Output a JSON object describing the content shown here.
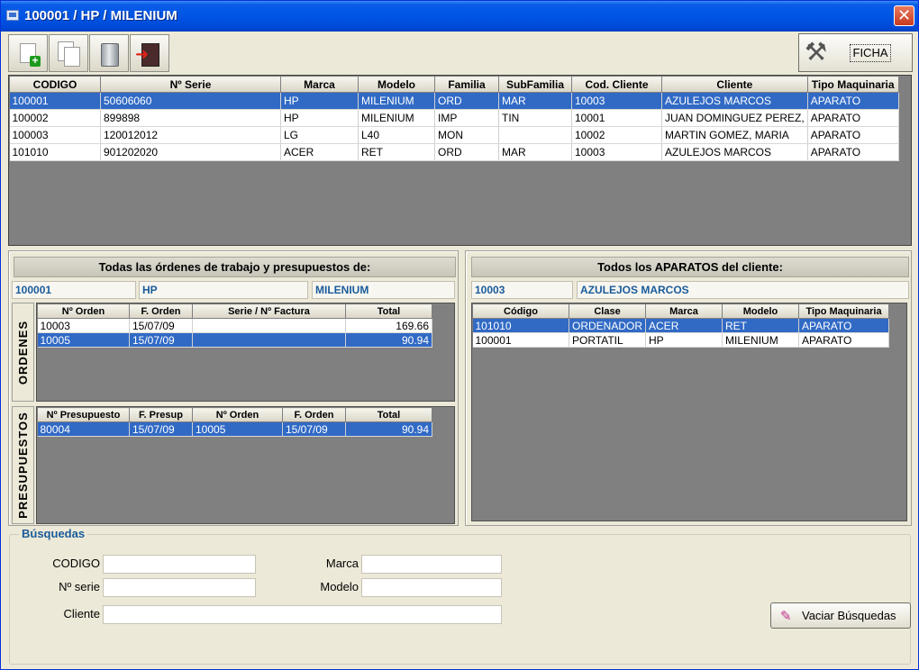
{
  "window": {
    "title": "100001 / HP / MILENIUM",
    "close": "✕"
  },
  "toolbar": {
    "ficha_label": "FICHA",
    "icons": [
      "new-document-icon",
      "copy-document-icon",
      "delete-trash-icon",
      "exit-door-icon",
      "tools-icon"
    ]
  },
  "main_grid": {
    "headers": [
      "CODIGO",
      "Nº Serie",
      "Marca",
      "Modelo",
      "Familia",
      "SubFamilia",
      "Cod. Cliente",
      "Cliente",
      "Tipo Maquinaria"
    ],
    "rows": [
      [
        "100001",
        "50606060",
        "HP",
        "MILENIUM",
        "ORD",
        "MAR",
        "10003",
        "AZULEJOS MARCOS",
        "APARATO"
      ],
      [
        "100002",
        "899898",
        "HP",
        "MILENIUM",
        "IMP",
        "TIN",
        "10001",
        "JUAN DOMINGUEZ PEREZ,",
        "APARATO"
      ],
      [
        "100003",
        "120012012",
        "LG",
        "L40",
        "MON",
        "",
        "10002",
        "MARTIN GOMEZ, MARIA",
        "APARATO"
      ],
      [
        "101010",
        "901202020",
        "ACER",
        "RET",
        "ORD",
        "MAR",
        "10003",
        "AZULEJOS MARCOS",
        "APARATO"
      ]
    ],
    "selected_row": 0
  },
  "left_panel": {
    "title": "Todas las órdenes de trabajo y presupuestos de:",
    "codigo": "100001",
    "marca": "HP",
    "modelo": "MILENIUM",
    "ordenes_label": "ORDENES",
    "ordenes_headers": [
      "Nº Orden",
      "F. Orden",
      "Serie   /   Nº Factura",
      "Total"
    ],
    "ordenes_rows": [
      [
        "10003",
        "15/07/09",
        "",
        "169.66"
      ],
      [
        "10005",
        "15/07/09",
        "",
        "90.94"
      ]
    ],
    "presupuestos_label": "PRESUPUESTOS",
    "presupuestos_headers": [
      "Nº Presupuesto",
      "F. Presup",
      "Nº Orden",
      "F. Orden",
      "Total"
    ],
    "presupuestos_rows": [
      [
        "80004",
        "15/07/09",
        "10005",
        "15/07/09",
        "90.94"
      ]
    ]
  },
  "right_panel": {
    "title": "Todos los APARATOS del cliente:",
    "cod_cliente": "10003",
    "cliente": "AZULEJOS MARCOS",
    "headers": [
      "Código",
      "Clase",
      "Marca",
      "Modelo",
      "Tipo Maquinaria"
    ],
    "rows": [
      [
        "101010",
        "ORDENADOR",
        "ACER",
        "RET",
        "APARATO"
      ],
      [
        "100001",
        "PORTATIL",
        "HP",
        "MILENIUM",
        "APARATO"
      ]
    ]
  },
  "search": {
    "title": "Búsquedas",
    "codigo_label": "CODIGO",
    "serie_label": "Nº serie",
    "cliente_label": "Cliente",
    "marca_label": "Marca",
    "modelo_label": "Modelo",
    "codigo_value": "",
    "serie_value": "",
    "cliente_value": "",
    "marca_value": "",
    "modelo_value": "",
    "clear_button": "Vaciar Búsquedas"
  },
  "colors": {
    "selection": "#316ac5",
    "titlebar": "#0055e5",
    "accent_text": "#1a5b9a",
    "grid_background": "#808080"
  }
}
